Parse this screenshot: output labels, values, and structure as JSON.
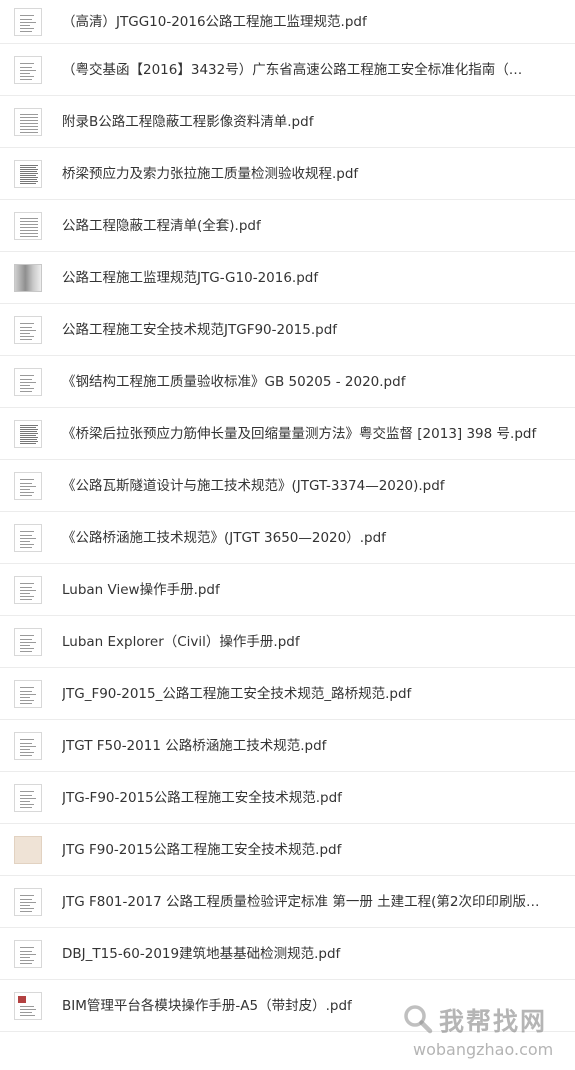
{
  "files": [
    {
      "name": "（高清）JTGG10-2016公路工程施工监理规范.pdf",
      "thumb": "doc"
    },
    {
      "name": "（粤交基函【2016】3432号）广东省高速公路工程施工安全标准化指南（…",
      "thumb": "doc"
    },
    {
      "name": "附录B公路工程隐蔽工程影像资料清单.pdf",
      "thumb": "table"
    },
    {
      "name": "桥梁预应力及索力张拉施工质量检测验收规程.pdf",
      "thumb": "dense"
    },
    {
      "name": "公路工程隐蔽工程清单(全套).pdf",
      "thumb": "table"
    },
    {
      "name": "公路工程施工监理规范JTG-G10-2016.pdf",
      "thumb": "photo"
    },
    {
      "name": "公路工程施工安全技术规范JTGF90-2015.pdf",
      "thumb": "doc"
    },
    {
      "name": "《钢结构工程施工质量验收标准》GB 50205 - 2020.pdf",
      "thumb": "doc"
    },
    {
      "name": "《桥梁后拉张预应力筋伸长量及回缩量量测方法》粤交监督 [2013] 398 号.pdf",
      "thumb": "dense"
    },
    {
      "name": "《公路瓦斯隧道设计与施工技术规范》(JTGT-3374—2020).pdf",
      "thumb": "doc"
    },
    {
      "name": "《公路桥涵施工技术规范》(JTGT 3650—2020）.pdf",
      "thumb": "doc"
    },
    {
      "name": "Luban View操作手册.pdf",
      "thumb": "doc"
    },
    {
      "name": "Luban Explorer（Civil）操作手册.pdf",
      "thumb": "doc"
    },
    {
      "name": "JTG_F90-2015_公路工程施工安全技术规范_路桥规范.pdf",
      "thumb": "doc"
    },
    {
      "name": "JTGT F50-2011 公路桥涵施工技术规范.pdf",
      "thumb": "doc"
    },
    {
      "name": "JTG-F90-2015公路工程施工安全技术规范.pdf",
      "thumb": "doc"
    },
    {
      "name": "JTG F90-2015公路工程施工安全技术规范.pdf",
      "thumb": "beige"
    },
    {
      "name": "JTG F801-2017 公路工程质量检验评定标准 第一册 土建工程(第2次印印刷版…",
      "thumb": "doc"
    },
    {
      "name": "DBJ_T15-60-2019建筑地基基础检测规范.pdf",
      "thumb": "doc"
    },
    {
      "name": "BIM管理平台各模块操作手册-A5（带封皮）.pdf",
      "thumb": "stamp"
    }
  ],
  "watermark": {
    "brand": "我帮找网",
    "url": "wobangzhao.com",
    "icon": "magnifier-icon"
  }
}
